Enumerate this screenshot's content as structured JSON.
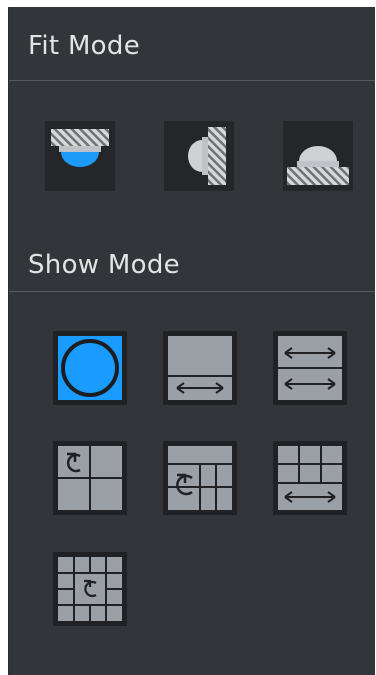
{
  "fit_mode": {
    "title": "Fit Mode",
    "options": [
      {
        "icon": "ceiling-mount-icon"
      },
      {
        "icon": "wall-mount-icon"
      },
      {
        "icon": "ground-mount-icon"
      }
    ]
  },
  "show_mode": {
    "title": "Show Mode",
    "options": [
      {
        "icon": "fisheye-original-icon",
        "selected": true
      },
      {
        "icon": "panorama-180-icon",
        "selected": false
      },
      {
        "icon": "dual-panorama-icon",
        "selected": false
      },
      {
        "icon": "one-plus-three-icon",
        "selected": false
      },
      {
        "icon": "one-plus-six-icon",
        "selected": false
      },
      {
        "icon": "panorama-plus-six-icon",
        "selected": false
      },
      {
        "icon": "one-plus-eight-icon",
        "selected": false
      }
    ]
  },
  "colors": {
    "panel_bg": "#32353a",
    "selected_bg": "#1a9cff",
    "accent_blue": "#1e9bfa",
    "tile_gray": "#9aa0a6"
  }
}
